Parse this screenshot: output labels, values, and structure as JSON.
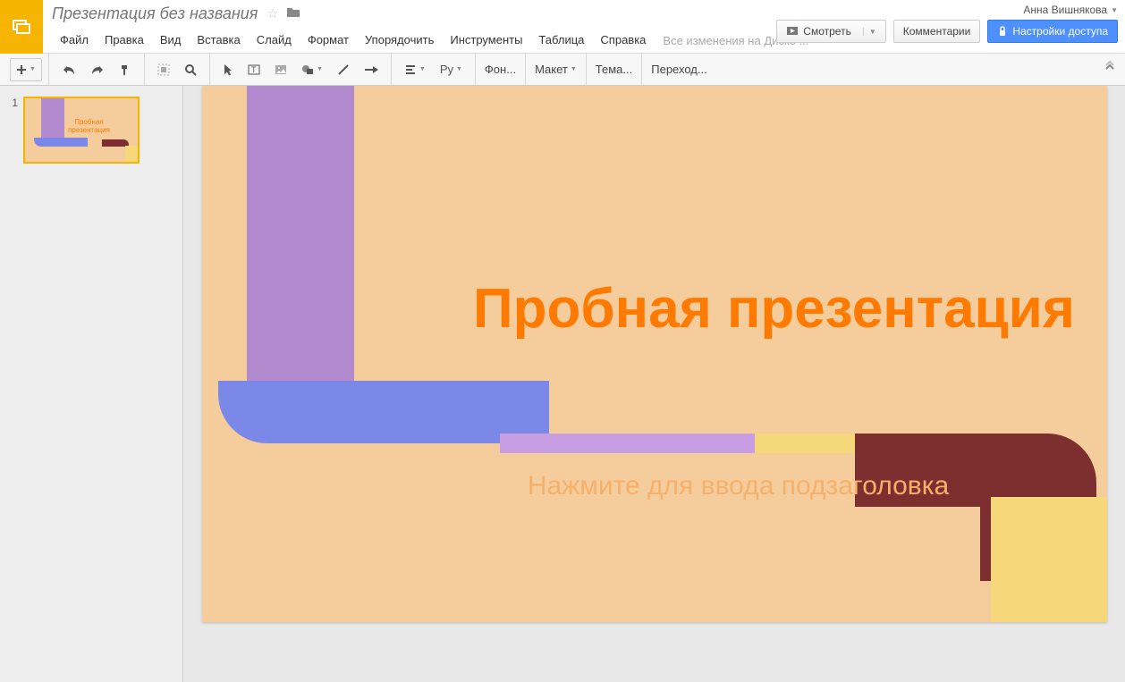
{
  "header": {
    "doc_title": "Презентация без названия",
    "user_name": "Анна Вишнякова",
    "drive_status": "Все изменения на Диске ..."
  },
  "menu": {
    "file": "Файл",
    "edit": "Правка",
    "view": "Вид",
    "insert": "Вставка",
    "slide": "Слайд",
    "format": "Формат",
    "arrange": "Упорядочить",
    "tools": "Инструменты",
    "table": "Таблица",
    "help": "Справка"
  },
  "buttons": {
    "present": "Смотреть",
    "comments": "Комментарии",
    "share": "Настройки доступа"
  },
  "toolbar": {
    "background": "Фон...",
    "layout": "Макет",
    "theme": "Тема...",
    "transition": "Переход...",
    "script_label": "Ру"
  },
  "thumbs": {
    "num1": "1",
    "thumb_title": "Пробная\nпрезентация"
  },
  "slide": {
    "title": "Пробная презентация",
    "subtitle": "Нажмите для ввода подзаголовка"
  }
}
